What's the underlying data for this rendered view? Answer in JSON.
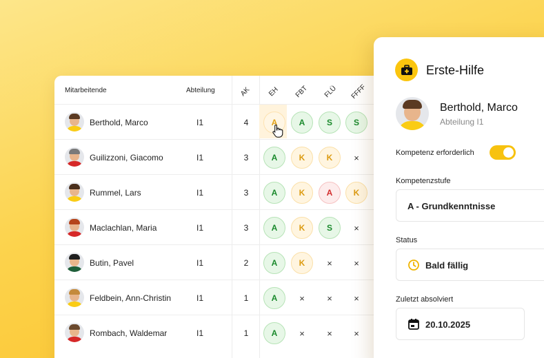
{
  "table": {
    "headers": {
      "employees": "Mitarbeitende",
      "department": "Abteilung",
      "ak": "AK",
      "skills": [
        "EH",
        "FBT",
        "FLÜ",
        "FFFF"
      ]
    },
    "rows": [
      {
        "name": "Berthold, Marco",
        "dept": "I1",
        "ak": "4",
        "cells": [
          {
            "v": "A",
            "t": "Adue"
          },
          {
            "v": "A",
            "t": "A"
          },
          {
            "v": "S",
            "t": "S"
          },
          {
            "v": "S",
            "t": "S"
          }
        ],
        "hair": "#5b3a22",
        "shirt": "#facc15"
      },
      {
        "name": "Guilizzoni, Giacomo",
        "dept": "I1",
        "ak": "3",
        "cells": [
          {
            "v": "A",
            "t": "A"
          },
          {
            "v": "K",
            "t": "K"
          },
          {
            "v": "K",
            "t": "K"
          },
          {
            "v": "×",
            "t": "none"
          }
        ],
        "hair": "#7a7a7a",
        "shirt": "#d62828"
      },
      {
        "name": "Rummel, Lars",
        "dept": "I1",
        "ak": "3",
        "cells": [
          {
            "v": "A",
            "t": "A"
          },
          {
            "v": "K",
            "t": "K"
          },
          {
            "v": "A",
            "t": "Ared"
          },
          {
            "v": "K",
            "t": "K"
          }
        ],
        "hair": "#4a2f1c",
        "shirt": "#facc15"
      },
      {
        "name": "Maclachlan, Maria",
        "dept": "I1",
        "ak": "3",
        "cells": [
          {
            "v": "A",
            "t": "A"
          },
          {
            "v": "K",
            "t": "K"
          },
          {
            "v": "S",
            "t": "S"
          },
          {
            "v": "×",
            "t": "none"
          }
        ],
        "hair": "#b5451b",
        "shirt": "#d62828"
      },
      {
        "name": "Butin, Pavel",
        "dept": "I1",
        "ak": "2",
        "cells": [
          {
            "v": "A",
            "t": "A"
          },
          {
            "v": "K",
            "t": "K"
          },
          {
            "v": "×",
            "t": "none"
          },
          {
            "v": "×",
            "t": "none"
          }
        ],
        "hair": "#1f1f1f",
        "shirt": "#1f5f3a"
      },
      {
        "name": "Feldbein, Ann-Christin",
        "dept": "I1",
        "ak": "1",
        "cells": [
          {
            "v": "A",
            "t": "A"
          },
          {
            "v": "×",
            "t": "none"
          },
          {
            "v": "×",
            "t": "none"
          },
          {
            "v": "×",
            "t": "none"
          }
        ],
        "hair": "#c48a3c",
        "shirt": "#facc15"
      },
      {
        "name": "Rombach, Waldemar",
        "dept": "I1",
        "ak": "1",
        "cells": [
          {
            "v": "A",
            "t": "A"
          },
          {
            "v": "×",
            "t": "none"
          },
          {
            "v": "×",
            "t": "none"
          },
          {
            "v": "×",
            "t": "none"
          }
        ],
        "hair": "#6b4a2e",
        "shirt": "#d62828"
      }
    ]
  },
  "panel": {
    "title": "Erste-Hilfe",
    "title_icon": "first-aid-kit-icon",
    "employee_name": "Berthold, Marco",
    "employee_dept": "Abteilung I1",
    "required_label": "Kompetenz erforderlich",
    "required_on": true,
    "level_label": "Kompetenzstufe",
    "level_value": "A - Grundkenntnisse",
    "status_label": "Status",
    "status_value": "Bald fällig",
    "status_icon": "clock-icon",
    "last_label": "Zuletzt absolviert",
    "last_value": "20.10.2025",
    "last_icon": "calendar-icon"
  },
  "colors": {
    "accent": "#fbc50e",
    "green": "#1b8a2d",
    "orange": "#dc9b12",
    "red": "#d32f2f"
  }
}
